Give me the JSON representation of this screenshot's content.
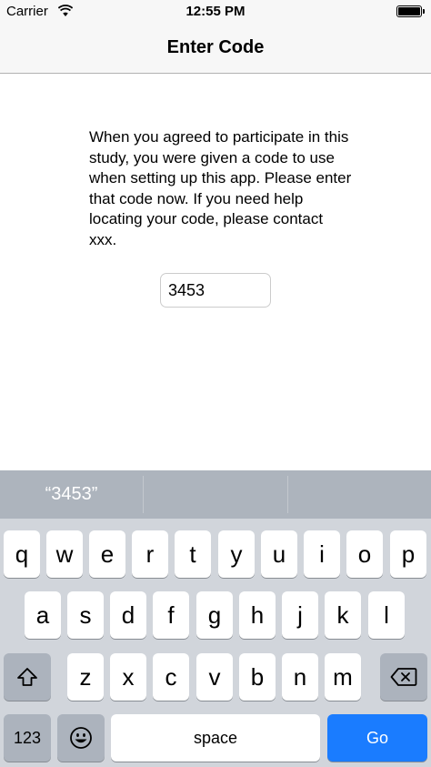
{
  "status_bar": {
    "carrier": "Carrier",
    "time": "12:55 PM"
  },
  "nav": {
    "title": "Enter Code"
  },
  "main": {
    "instructions": "When you agreed to participate in this study, you were given a code to use when setting up this app. Please enter that code now. If you need help locating your code, please contact xxx.",
    "code_value": "3453"
  },
  "keyboard": {
    "suggestion": "“3453”",
    "row1": [
      "q",
      "w",
      "e",
      "r",
      "t",
      "y",
      "u",
      "i",
      "o",
      "p"
    ],
    "row2": [
      "a",
      "s",
      "d",
      "f",
      "g",
      "h",
      "j",
      "k",
      "l"
    ],
    "row3": [
      "z",
      "x",
      "c",
      "v",
      "b",
      "n",
      "m"
    ],
    "numbers_label": "123",
    "space_label": "space",
    "go_label": "Go",
    "icons": {
      "shift": "shift-icon",
      "delete": "delete-icon",
      "emoji": "emoji-icon"
    },
    "colors": {
      "go": "#1a7cff",
      "keyboard_bg": "#d1d5db"
    }
  }
}
